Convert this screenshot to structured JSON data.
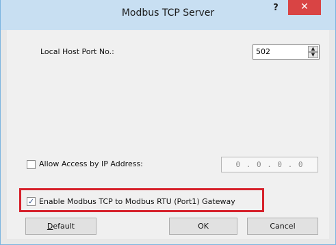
{
  "dialog": {
    "title": "Modbus TCP Server",
    "help_glyph": "?",
    "close_glyph": "✕"
  },
  "local_port": {
    "label": "Local Host Port No.:",
    "value": "502"
  },
  "allow_access": {
    "label": "Allow Access by IP Address:",
    "checked": false,
    "ip_value": "0 . 0 . 0 . 0"
  },
  "gateway": {
    "label": "Enable Modbus TCP to Modbus RTU (Port1) Gateway",
    "checked": true,
    "highlight_color": "#d6212b"
  },
  "buttons": {
    "default_first": "D",
    "default_rest": "efault",
    "ok": "OK",
    "cancel": "Cancel"
  }
}
